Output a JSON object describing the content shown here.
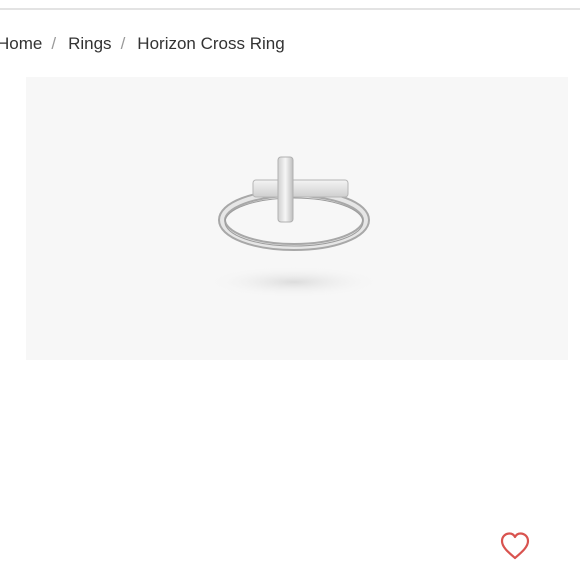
{
  "breadcrumb": {
    "items": [
      {
        "label": "Home"
      },
      {
        "label": "Rings"
      },
      {
        "label": "Horizon Cross Ring"
      }
    ],
    "separator": "/"
  },
  "product_image": {
    "subject": "sterling silver ring with horizontal cross",
    "background_color": "#f7f7f7"
  },
  "wishlist": {
    "icon": "heart-outline-icon",
    "color": "#d9534f"
  }
}
